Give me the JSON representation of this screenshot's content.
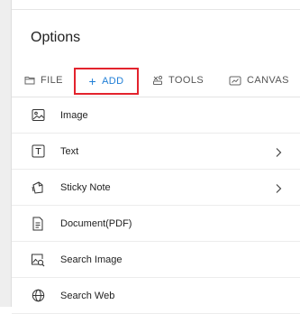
{
  "panel": {
    "title": "Options"
  },
  "tabs": [
    {
      "label": "FILE",
      "icon": "folder-icon"
    },
    {
      "label": "ADD",
      "icon": "plus-icon"
    },
    {
      "label": "TOOLS",
      "icon": "tools-icon"
    },
    {
      "label": "CANVAS",
      "icon": "canvas-icon"
    }
  ],
  "colors": {
    "active_tab": "#1f7ed6",
    "highlight_border": "#e3232d"
  },
  "items": [
    {
      "label": "Image",
      "icon": "image-icon",
      "has_submenu": false
    },
    {
      "label": "Text",
      "icon": "text-icon",
      "has_submenu": true
    },
    {
      "label": "Sticky Note",
      "icon": "sticky-note-icon",
      "has_submenu": true
    },
    {
      "label": "Document(PDF)",
      "icon": "document-icon",
      "has_submenu": false
    },
    {
      "label": "Search Image",
      "icon": "search-image-icon",
      "has_submenu": false
    },
    {
      "label": "Search Web",
      "icon": "globe-icon",
      "has_submenu": false
    }
  ]
}
